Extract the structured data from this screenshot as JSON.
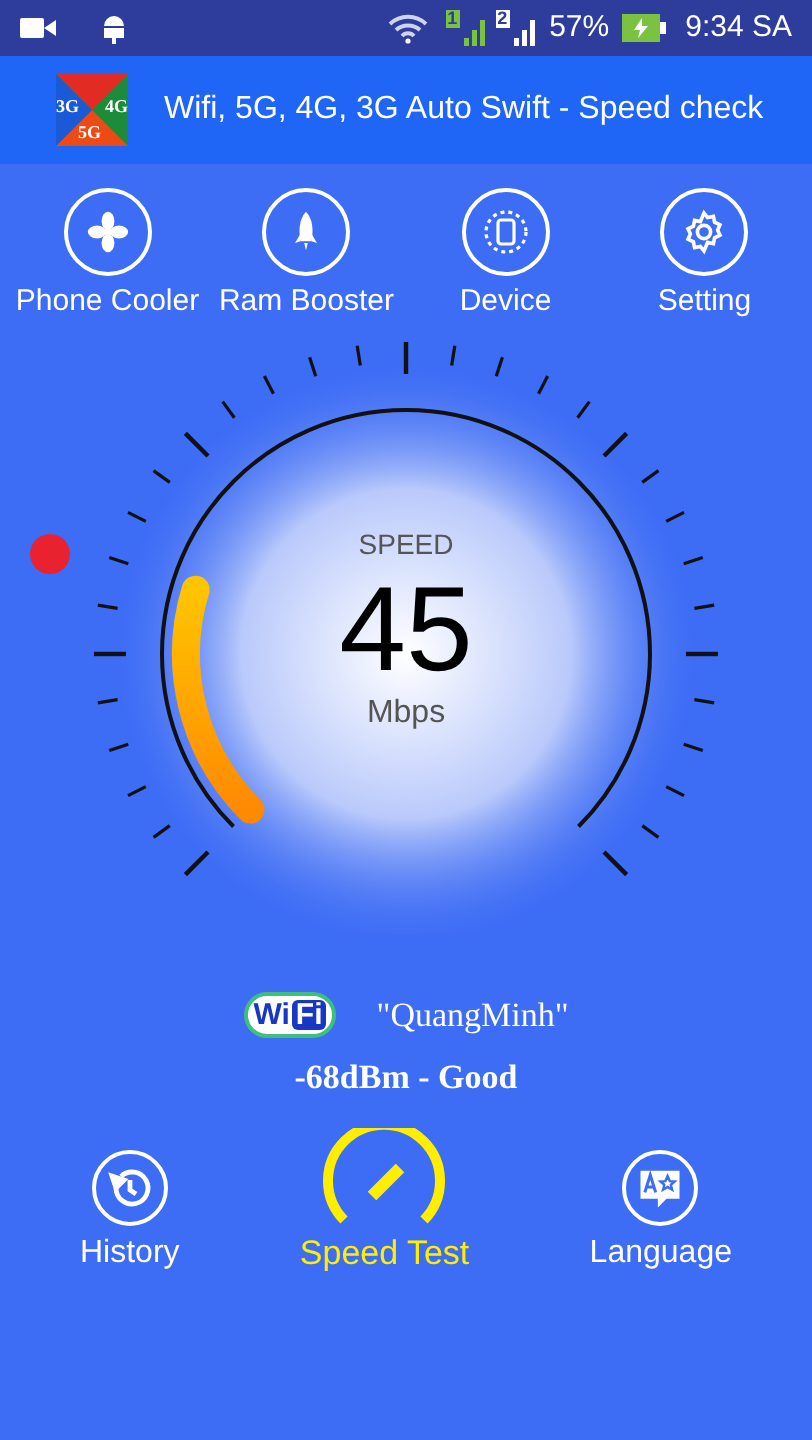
{
  "status_bar": {
    "sims": [
      "1",
      "2"
    ],
    "battery": "57%",
    "time": "9:34 SA"
  },
  "header": {
    "title": "Wifi, 5G, 4G, 3G Auto Swift - Speed check",
    "logo_labels": [
      "3G",
      "4G",
      "5G"
    ]
  },
  "tools": [
    {
      "kind": "fan",
      "label": "Phone Cooler"
    },
    {
      "kind": "rocket",
      "label": "Ram Booster"
    },
    {
      "kind": "device",
      "label": "Device"
    },
    {
      "kind": "gear",
      "label": "Setting"
    }
  ],
  "gauge": {
    "caption": "SPEED",
    "value": "45",
    "unit": "Mbps"
  },
  "network": {
    "badge": [
      "Wi",
      "Fi"
    ],
    "name": "\"QuangMinh\"",
    "signal": "-68dBm - Good"
  },
  "bottom": [
    {
      "kind": "history",
      "label": "History"
    },
    {
      "kind": "speed",
      "label": "Speed Test"
    },
    {
      "kind": "language",
      "label": "Language"
    }
  ]
}
